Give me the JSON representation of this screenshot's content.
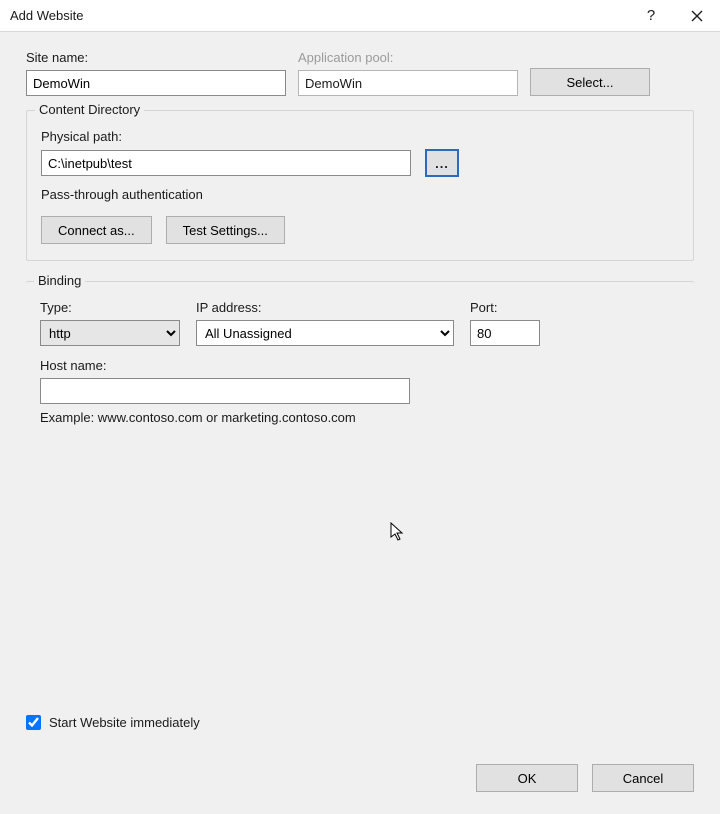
{
  "window": {
    "title": "Add Website",
    "help_glyph": "?"
  },
  "site": {
    "name_label": "Site name:",
    "name_value": "DemoWin",
    "pool_label": "Application pool:",
    "pool_value": "DemoWin",
    "select_label": "Select..."
  },
  "content_dir": {
    "legend": "Content Directory",
    "path_label": "Physical path:",
    "path_value": "C:\\inetpub\\test",
    "browse_label": "...",
    "pass_label": "Pass-through authentication",
    "connect_label": "Connect as...",
    "test_label": "Test Settings..."
  },
  "binding": {
    "legend": "Binding",
    "type_label": "Type:",
    "type_value": "http",
    "ip_label": "IP address:",
    "ip_value": "All Unassigned",
    "port_label": "Port:",
    "port_value": "80",
    "host_label": "Host name:",
    "host_value": "",
    "example": "Example: www.contoso.com or marketing.contoso.com"
  },
  "start": {
    "label": "Start Website immediately",
    "checked": true
  },
  "actions": {
    "ok": "OK",
    "cancel": "Cancel"
  }
}
